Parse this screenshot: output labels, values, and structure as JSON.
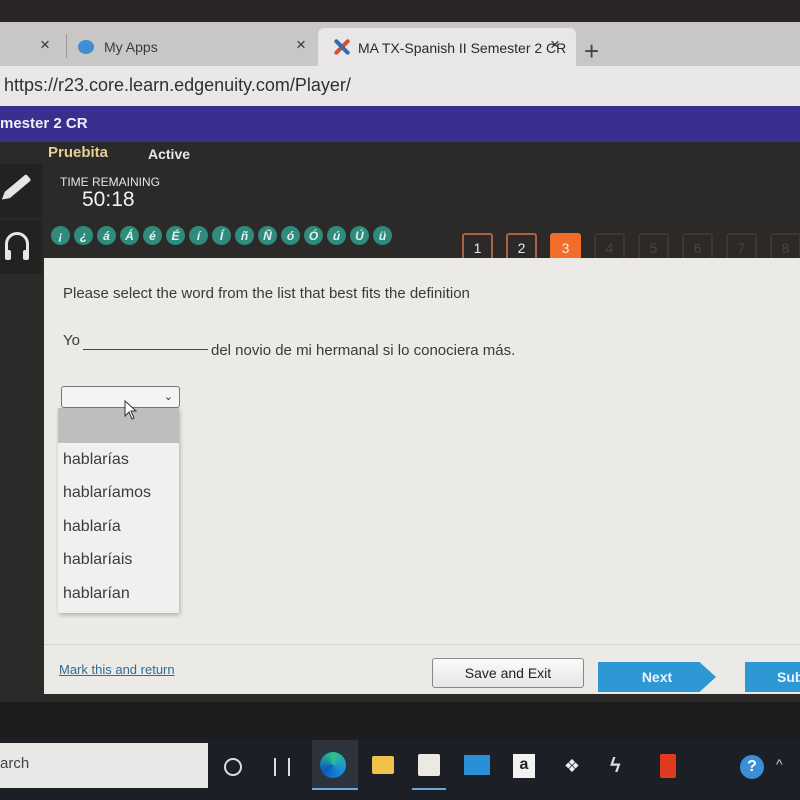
{
  "browser": {
    "tabs": [
      {
        "label": "",
        "close": "×"
      },
      {
        "label": "My Apps",
        "close": "×"
      },
      {
        "label": "MA TX-Spanish II Semester 2 CR",
        "close": "×",
        "active": true
      }
    ],
    "new_tab": "+",
    "url": "https://r23.core.learn.edgenuity.com/Player/"
  },
  "course": {
    "title": "mester 2 CR",
    "activity": "Pruebita",
    "status": "Active"
  },
  "timer": {
    "label": "TIME REMAINING",
    "value": "50:18"
  },
  "accents": [
    "¡",
    "¿",
    "á",
    "Á",
    "é",
    "É",
    "í",
    "Í",
    "ñ",
    "Ñ",
    "ó",
    "Ó",
    "ú",
    "Ú",
    "ü"
  ],
  "pages": [
    {
      "label": "1",
      "state": "visited"
    },
    {
      "label": "2",
      "state": "visited"
    },
    {
      "label": "3",
      "state": "current"
    },
    {
      "label": "4",
      "state": "locked"
    },
    {
      "label": "5",
      "state": "locked"
    },
    {
      "label": "6",
      "state": "locked"
    },
    {
      "label": "7",
      "state": "locked"
    },
    {
      "label": "8",
      "state": "locked"
    }
  ],
  "question": {
    "instructions": "Please select the word from the list that best fits the definition",
    "sentence_start": "Yo",
    "sentence_end": "del novio de mi hermanal si lo conociera más.",
    "selected": "",
    "options": [
      "",
      "hablarías",
      "hablaríamos",
      "hablaría",
      "hablaríais",
      "hablarían"
    ]
  },
  "footer": {
    "mark_link": "Mark this and return",
    "save_exit": "Save and Exit",
    "next": "Next",
    "submit": "Sub"
  },
  "taskbar": {
    "search_text": "arch",
    "amazon_glyph": "a",
    "dropbox_glyph": "❖",
    "s_glyph": "ϟ",
    "help_glyph": "?",
    "chevron": "^"
  },
  "colors": {
    "course_bar": "#3a2e8e",
    "current_page": "#f26c2a",
    "accent_button": "#2f8c7d",
    "next_button": "#2d98d4",
    "activity_title": "#e3cf98"
  }
}
